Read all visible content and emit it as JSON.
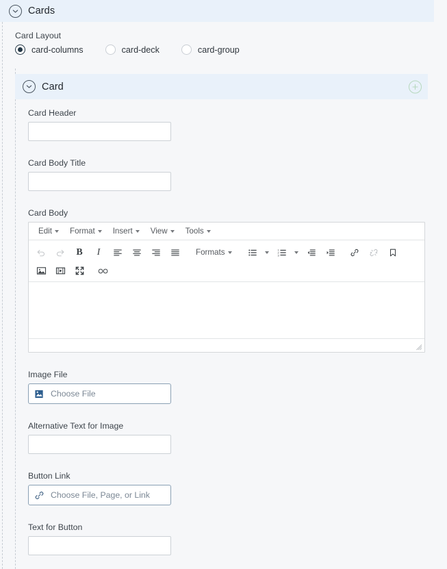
{
  "sections": {
    "cards": {
      "title": "Cards",
      "collapse_icon": "chevron-down-icon"
    },
    "card": {
      "title": "Card",
      "collapse_icon": "chevron-down-icon",
      "add_icon": "plus-circle-icon"
    }
  },
  "card_layout": {
    "label": "Card Layout",
    "options": [
      {
        "label": "card-columns",
        "selected": true
      },
      {
        "label": "card-deck",
        "selected": false
      },
      {
        "label": "card-group",
        "selected": false
      }
    ]
  },
  "fields": {
    "card_header": {
      "label": "Card Header",
      "value": "",
      "placeholder": ""
    },
    "card_body_title": {
      "label": "Card Body Title",
      "value": "",
      "placeholder": ""
    },
    "card_body": {
      "label": "Card Body",
      "value": ""
    },
    "image_file": {
      "label": "Image File",
      "button_text": "Choose File",
      "icon": "image-file-icon"
    },
    "alt_text": {
      "label": "Alternative Text for Image",
      "value": "",
      "placeholder": ""
    },
    "button_link": {
      "label": "Button Link",
      "button_text": "Choose File, Page, or Link",
      "icon": "link-icon"
    },
    "button_text": {
      "label": "Text for Button",
      "value": "",
      "placeholder": ""
    }
  },
  "editor": {
    "menus": [
      {
        "label": "Edit"
      },
      {
        "label": "Format"
      },
      {
        "label": "Insert"
      },
      {
        "label": "View"
      },
      {
        "label": "Tools"
      }
    ],
    "toolbar_row1": [
      {
        "name": "undo-icon",
        "label": "",
        "disabled": true
      },
      {
        "name": "redo-icon",
        "label": "",
        "disabled": true
      },
      {
        "name": "bold-icon",
        "label": "B"
      },
      {
        "name": "italic-icon",
        "label": "I"
      },
      {
        "name": "align-left-icon",
        "label": ""
      },
      {
        "name": "align-center-icon",
        "label": ""
      },
      {
        "name": "align-right-icon",
        "label": ""
      },
      {
        "name": "align-justify-icon",
        "label": ""
      },
      {
        "name": "formats-menu",
        "label": "Formats"
      },
      {
        "name": "bullet-list-icon",
        "label": ""
      },
      {
        "name": "numbered-list-icon",
        "label": ""
      },
      {
        "name": "outdent-icon",
        "label": ""
      },
      {
        "name": "indent-icon",
        "label": ""
      },
      {
        "name": "link-icon",
        "label": ""
      },
      {
        "name": "unlink-icon",
        "label": "",
        "disabled": true
      },
      {
        "name": "anchor-icon",
        "label": ""
      }
    ],
    "toolbar_row2": [
      {
        "name": "insert-image-icon",
        "label": ""
      },
      {
        "name": "insert-media-icon",
        "label": ""
      },
      {
        "name": "fullscreen-icon",
        "label": ""
      },
      {
        "name": "special-character-icon",
        "label": ""
      }
    ],
    "formats_label": "Formats",
    "resize_handle": "resize-grip-icon"
  },
  "colors": {
    "page_background": "#f6f7f9",
    "section_header_background": "#e9f1fa",
    "radio_selected": "#243746",
    "add_icon": "#b6d8bd",
    "chooser_border": "#8aa0b4",
    "placeholder_text": "#7b8794"
  }
}
